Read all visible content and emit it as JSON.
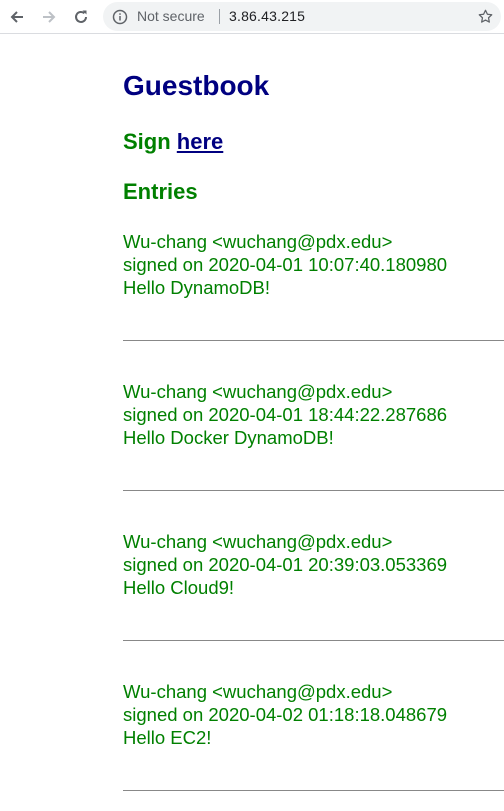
{
  "browser": {
    "security_label": "Not secure",
    "url": "3.86.43.215"
  },
  "page": {
    "title": "Guestbook",
    "sign_prefix": "Sign",
    "sign_link": "here",
    "entries_heading": "Entries"
  },
  "entries": [
    {
      "author": "Wu-chang <wuchang@pdx.edu>",
      "signed": "signed on 2020-04-01 10:07:40.180980",
      "message": "Hello DynamoDB!"
    },
    {
      "author": "Wu-chang <wuchang@pdx.edu>",
      "signed": "signed on 2020-04-01 18:44:22.287686",
      "message": "Hello Docker DynamoDB!"
    },
    {
      "author": "Wu-chang <wuchang@pdx.edu>",
      "signed": "signed on 2020-04-01 20:39:03.053369",
      "message": "Hello Cloud9!"
    },
    {
      "author": "Wu-chang <wuchang@pdx.edu>",
      "signed": "signed on 2020-04-02 01:18:18.048679",
      "message": "Hello EC2!"
    }
  ]
}
